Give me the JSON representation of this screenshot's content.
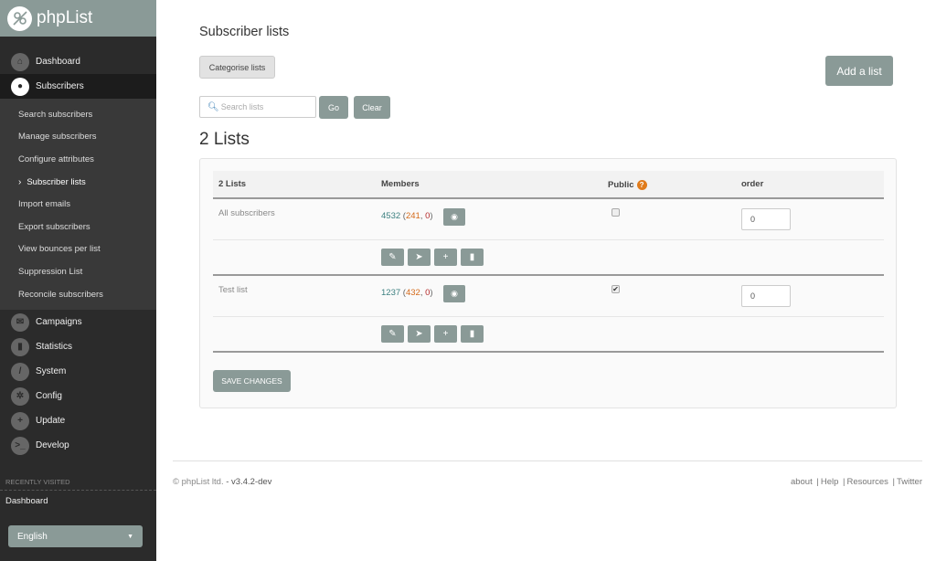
{
  "app": {
    "name": "phpList"
  },
  "sidebar": {
    "items": [
      {
        "label": "Dashboard",
        "icon": "home-icon"
      },
      {
        "label": "Subscribers",
        "icon": "user-icon",
        "active": true
      }
    ],
    "subitems": [
      {
        "label": "Search subscribers"
      },
      {
        "label": "Manage subscribers"
      },
      {
        "label": "Configure attributes"
      },
      {
        "label": "Subscriber lists",
        "current": true
      },
      {
        "label": "Import emails"
      },
      {
        "label": "Export subscribers"
      },
      {
        "label": "View bounces per list"
      },
      {
        "label": "Suppression List"
      },
      {
        "label": "Reconcile subscribers"
      }
    ],
    "items_after": [
      {
        "label": "Campaigns",
        "icon": "envelope-icon"
      },
      {
        "label": "Statistics",
        "icon": "bar-chart-icon"
      },
      {
        "label": "System",
        "icon": "wrench-icon"
      },
      {
        "label": "Config",
        "icon": "gear-icon"
      },
      {
        "label": "Update",
        "icon": "plus-icon"
      },
      {
        "label": "Develop",
        "icon": "terminal-icon"
      }
    ],
    "recent_heading": "RECENTLY VISITED",
    "recent_items": [
      "Dashboard"
    ],
    "language": "English"
  },
  "main": {
    "title": "Subscriber lists",
    "categorise_label": "Categorise lists",
    "add_label": "Add a list",
    "search_placeholder": "Search lists",
    "go_label": "Go",
    "clear_label": "Clear",
    "count_title": "2 Lists",
    "table": {
      "headers": {
        "name": "2 Lists",
        "members": "Members",
        "public": "Public",
        "order": "order"
      },
      "rows": [
        {
          "name": "All subscribers",
          "total": "4532",
          "unconfirmed": "241",
          "blacklisted": "0",
          "public": false,
          "order": "0"
        },
        {
          "name": "Test list",
          "total": "1237",
          "unconfirmed": "432",
          "blacklisted": "0",
          "public": true,
          "order": "0"
        }
      ]
    },
    "save_label": "SAVE CHANGES"
  },
  "footer": {
    "copyright": "© phpList ltd.",
    "version": "- v3.4.2-dev",
    "links": [
      "about",
      "Help",
      "Resources",
      "Twitter"
    ]
  }
}
